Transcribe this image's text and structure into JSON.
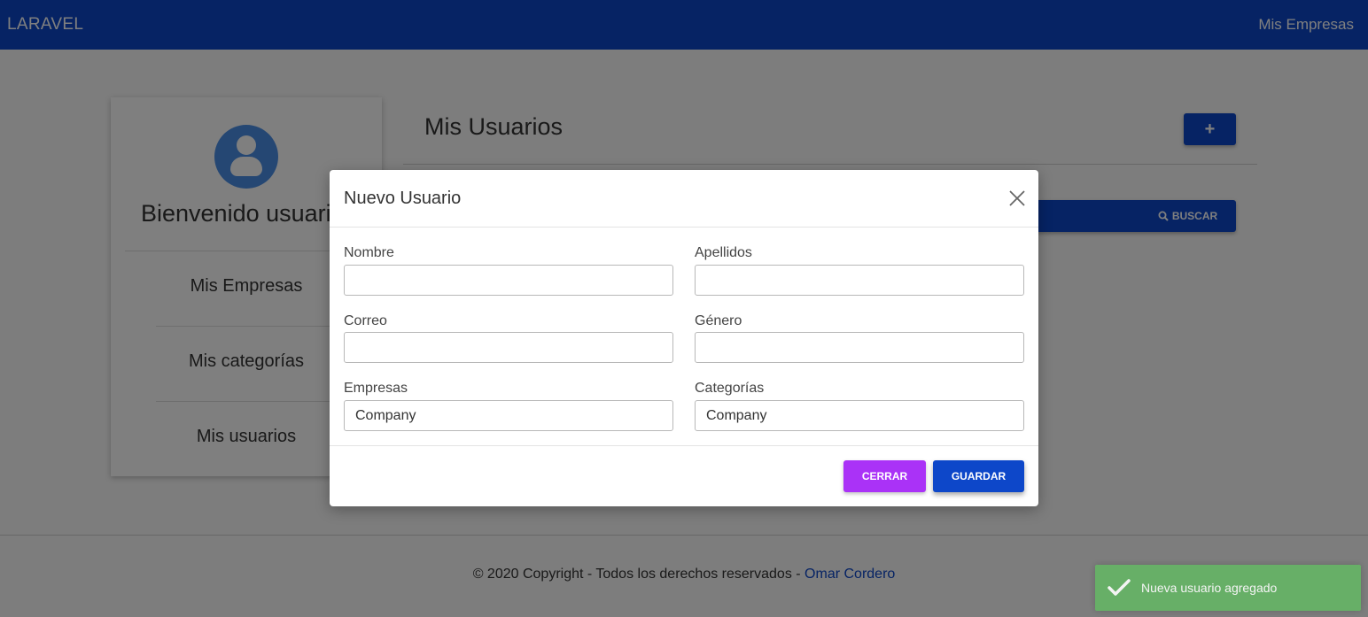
{
  "navbar": {
    "brand": "LARAVEL",
    "link": "Mis Empresas"
  },
  "sidebar": {
    "welcome": "Bienvenido usuario",
    "items": [
      {
        "label": "Mis Empresas"
      },
      {
        "label": "Mis categorías"
      },
      {
        "label": "Mis usuarios"
      }
    ]
  },
  "main": {
    "title": "Mis Usuarios",
    "add_label": "+",
    "search_label": "BUSCAR"
  },
  "modal": {
    "title": "Nuevo Usuario",
    "fields": {
      "nombre": {
        "label": "Nombre",
        "value": ""
      },
      "apellidos": {
        "label": "Apellidos",
        "value": ""
      },
      "correo": {
        "label": "Correo",
        "value": ""
      },
      "genero": {
        "label": "Género",
        "value": ""
      },
      "empresas": {
        "label": "Empresas",
        "value": "Company"
      },
      "categorias": {
        "label": "Categorías",
        "value": "Company"
      }
    },
    "close_label": "CERRAR",
    "save_label": "GUARDAR"
  },
  "footer": {
    "text": "© 2020 Copyright - Todos los derechos reservados - ",
    "author": "Omar Cordero"
  },
  "toast": {
    "message": "Nueva usuario agregado"
  },
  "colors": {
    "primary": "#0d47c9",
    "secondary": "#aa32f7",
    "success": "#66b466"
  }
}
